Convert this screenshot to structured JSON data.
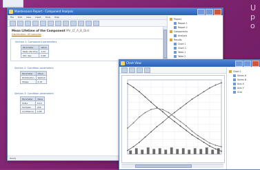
{
  "corner_text": [
    "U",
    "p",
    "o"
  ],
  "back_window": {
    "title": "Maintenance Report - Component Analysis",
    "menu": [
      "File",
      "Edit",
      "View",
      "Insert",
      "Tools",
      "Help"
    ],
    "heading": "Mean Lifetime of the Component",
    "heading_suffix": "MV_LT_A_B_Dist",
    "link_text": "Distribution: All samples",
    "sections": [
      {
        "label": "Section 1: Component parameters",
        "rows": [
          [
            "Parameter",
            "Value"
          ],
          [
            "Mean life time",
            "1.22"
          ],
          [
            "Std. dev.",
            "0.48"
          ]
        ]
      },
      {
        "label": "Section 2: Condition parameters",
        "rows": [
          [
            "Parameter",
            "Value"
          ],
          [
            "Distribution",
            "Weibull"
          ],
          [
            "Shape",
            "2.10"
          ]
        ]
      },
      {
        "label": "Section 3: Condition parameters",
        "rows": [
          [
            "Parameter",
            "Value"
          ],
          [
            "Scale",
            "14.0"
          ],
          [
            "Samples",
            "245"
          ],
          [
            "Confidence",
            "0.95"
          ]
        ]
      }
    ],
    "status": "Ready",
    "tree": [
      "Project",
      "Report 1",
      "Report 2",
      "Components",
      "Analysis",
      "Results",
      "Chart 1",
      "Chart 2",
      "Table 1",
      "Table 2",
      "Summary"
    ]
  },
  "front_window": {
    "title": "Chart View",
    "tree": [
      "Chart 1",
      "Series A",
      "Series B",
      "Axis X",
      "Axis Y",
      "Grid"
    ],
    "chart_data": {
      "type": "line",
      "x": [
        0,
        1,
        2,
        3,
        4,
        5,
        6,
        7,
        8,
        9,
        10,
        11,
        12,
        13,
        14,
        15,
        16
      ],
      "series": [
        {
          "values": [
            0.95,
            0.9,
            0.84,
            0.77,
            0.7,
            0.63,
            0.57,
            0.5,
            0.44,
            0.38,
            0.32,
            0.26,
            0.21,
            0.16,
            0.11,
            0.07,
            0.04
          ]
        },
        {
          "values": [
            0.05,
            0.1,
            0.16,
            0.23,
            0.3,
            0.37,
            0.43,
            0.5,
            0.56,
            0.62,
            0.68,
            0.74,
            0.79,
            0.84,
            0.89,
            0.93,
            0.96
          ]
        },
        {
          "values": [
            0.35,
            0.42,
            0.5,
            0.56,
            0.6,
            0.62,
            0.6,
            0.56,
            0.5,
            0.44,
            0.38,
            0.31,
            0.25,
            0.2,
            0.15,
            0.12,
            0.1
          ]
        }
      ],
      "bars": [
        0.05,
        0.08,
        0.06,
        0.09,
        0.07,
        0.08,
        0.06,
        0.09,
        0.07,
        0.08,
        0.06,
        0.08,
        0.07,
        0.09,
        0.06,
        0.08
      ],
      "ylim": [
        0,
        1
      ],
      "grid": true,
      "colors": {
        "series": [
          "#4a4a4a",
          "#5a5a5a",
          "#777777"
        ],
        "bars": "#6a6a6a"
      }
    }
  }
}
